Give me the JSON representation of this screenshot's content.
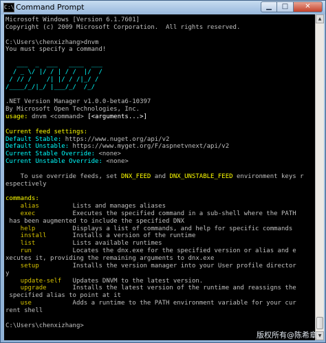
{
  "window": {
    "title": "Command Prompt",
    "icon_label": "C:\\",
    "minimize_symbol": "▁",
    "maximize_symbol": "□",
    "close_symbol": "✕"
  },
  "console": {
    "header_line1": "Microsoft Windows [Version 6.1.7601]",
    "header_line2": "Copyright (c) 2009 Microsoft Corporation.  All rights reserved.",
    "prompt1": "C:\\Users\\chenxizhang>dnvm",
    "msg_specify": "You must specify a command!",
    "banner": [
      "   ___  _  ___   ____  ___",
      "  / _ \\/ |/ / | / /  |/  /",
      " / // /    /| |/ / /|_/ /",
      "/____/_/|_/ |___/_/  /_/"
    ],
    "version_line": ".NET Version Manager v1.0.0-beta6-10397",
    "by_line": "By Microsoft Open Technologies, Inc.",
    "usage_label": "usage:",
    "usage_cmd": "dnvm",
    "usage_args1": "<command>",
    "usage_args2": "[<arguments...>]",
    "feed_heading": "Current feed settings:",
    "feeds": [
      {
        "label": "Default Stable:",
        "value": "https://www.nuget.org/api/v2"
      },
      {
        "label": "Default Unstable:",
        "value": "https://www.myget.org/F/aspnetvnext/api/v2"
      },
      {
        "label": "Current Stable Override:",
        "value": "<none>"
      },
      {
        "label": "Current Unstable Override:",
        "value": "<none>"
      }
    ],
    "override_pre": "    To use override feeds, set ",
    "override_var1": "DNX_FEED",
    "override_mid": " and ",
    "override_var2": "DNX_UNSTABLE_FEED",
    "override_post": " environment keys r",
    "override_wrap": "espectively",
    "commands_heading": "commands:",
    "cmd_alias": "    alias",
    "desc_alias": "Lists and manages aliases",
    "cmd_exec": "    exec",
    "desc_exec": "Executes the specified command in a sub-shell where the PATH",
    "wrap_exec": " has been augmented to include the specified DNX",
    "cmd_help": "    help",
    "desc_help": "Displays a list of commands, and help for specific commands",
    "cmd_install": "    install",
    "desc_install": "Installs a version of the runtime",
    "cmd_list": "    list",
    "desc_list": "Lists available runtimes",
    "cmd_run": "    run",
    "desc_run": "Locates the dnx.exe for the specified version or alias and e",
    "wrap_run": "xecutes it, providing the remaining arguments to dnx.exe",
    "cmd_setup": "    setup",
    "desc_setup": "Installs the version manager into your User profile director",
    "wrap_setup": "y",
    "cmd_update_self": "    update-self",
    "desc_update_self": "Updates DNVM to the latest version.",
    "cmd_upgrade": "    upgrade",
    "desc_upgrade": "Installs the latest version of the runtime and reassigns the",
    "wrap_upgrade": " specified alias to point at it",
    "cmd_use": "    use",
    "desc_use": "Adds a runtime to the PATH environment variable for your cur",
    "wrap_use": "rent shell",
    "prompt2": "C:\\Users\\chenxizhang>"
  },
  "scrollbar": {
    "up_symbol": "▲",
    "down_symbol": "▼"
  },
  "watermark": "版权所有@陈希章",
  "colors": {
    "console_bg": "#000000",
    "text": "#c0c0c0",
    "yellow": "#ffff00",
    "cyan": "#00ffff",
    "dark_yellow": "#d7c300"
  }
}
